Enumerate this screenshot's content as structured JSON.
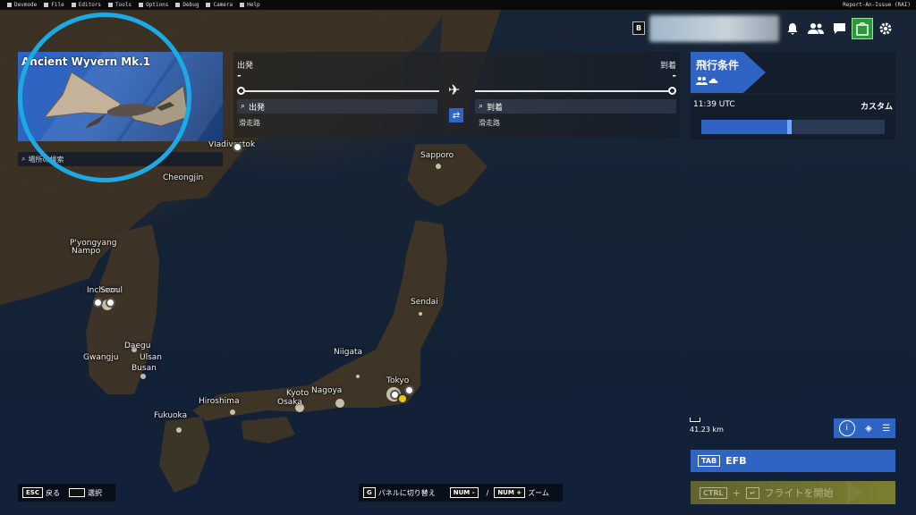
{
  "devbar": {
    "items": [
      "Devmode",
      "File",
      "Editors",
      "Tools",
      "Options",
      "Debug",
      "Camera",
      "Help"
    ],
    "right": "Report-An-Issue (RAI)"
  },
  "top": {
    "key_b": "B",
    "icons": [
      "bell-icon",
      "users-icon",
      "chat-icon",
      "marketplace-icon",
      "gear-icon"
    ]
  },
  "aircraft": {
    "name": "Ancient Wyvern Mk.1",
    "search_placeholder": "場所の検索"
  },
  "route": {
    "departure_label": "出発",
    "arrival_label": "到着",
    "departure_value": "-",
    "arrival_value": "-",
    "departure_field": "出発",
    "arrival_field": "到着",
    "departure_runway": "滑走路",
    "arrival_runway": "滑走路"
  },
  "conditions": {
    "title": "飛行条件",
    "time": "11:39 UTC",
    "mode": "カスタム",
    "time_of_day_fraction": 0.48
  },
  "map": {
    "scale": "41.23  km",
    "cities": [
      "Vladivostok",
      "Cheongjin",
      "P'yongyang",
      "Nampo",
      "Incheon",
      "Seoul",
      "Daegu",
      "Ulsan",
      "Gwangju",
      "Busan",
      "Sapporo",
      "Sendai",
      "Niigata",
      "Tokyo",
      "Kyoto",
      "Nagoya",
      "Osaka",
      "Hiroshima",
      "Fukuoka"
    ]
  },
  "efb": {
    "key": "TAB",
    "label": "EFB"
  },
  "start_flight": {
    "key": "CTRL",
    "plus": "+",
    "key2": "↵",
    "label": "フライトを開始"
  },
  "hints": {
    "esc_key": "ESC",
    "esc_label": "戻る",
    "select_label": "選択",
    "g_key": "G",
    "g_label": "パネルに切り替え",
    "zoom_minus": "NUM -",
    "zoom_slash": "/",
    "zoom_plus": "NUM +",
    "zoom_label": "ズーム"
  },
  "colors": {
    "accent": "#2f64c5",
    "highlight_circle": "#1ca9e4",
    "marketplace": "#2a9a38"
  }
}
